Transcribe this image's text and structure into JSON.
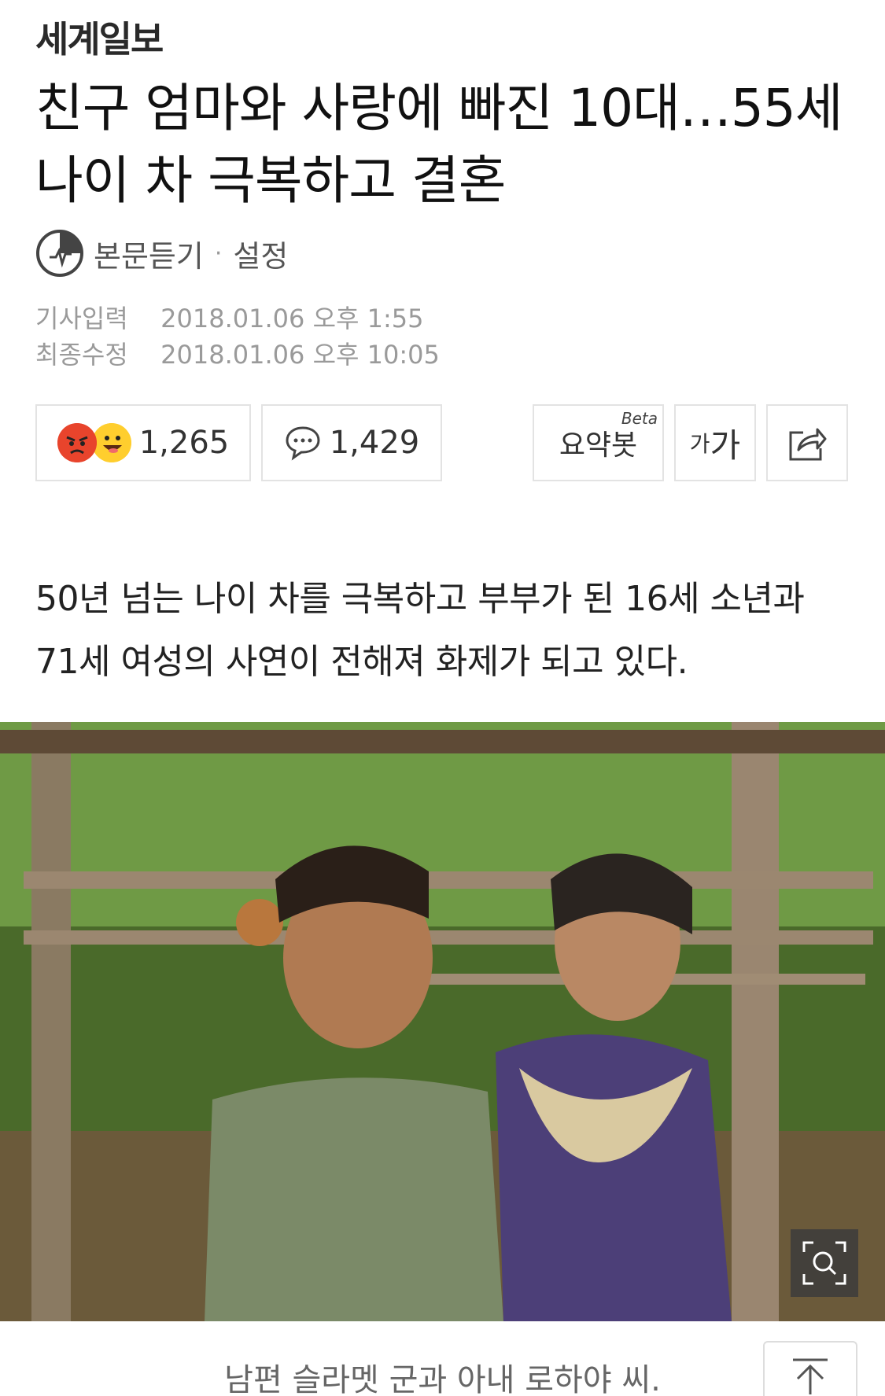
{
  "publisher": {
    "name": "세계일보"
  },
  "headline": "친구 엄마와 사랑에 빠진 10대…55세 나이 차 극복하고 결혼",
  "tts": {
    "label": "본문듣기",
    "separator": "·",
    "settings": "설정"
  },
  "meta": {
    "published_label": "기사입력",
    "published_value": "2018.01.06 오후 1:55",
    "modified_label": "최종수정",
    "modified_value": "2018.01.06 오후 10:05"
  },
  "actions": {
    "reaction_count": "1,265",
    "comment_count": "1,429",
    "summary_label": "요약봇",
    "summary_badge": "Beta",
    "font_small": "가",
    "font_big": "가"
  },
  "lead": "50년 넘는 나이 차를 극복하고 부부가 된 16세 소년과 71세 여성의 사연이 전해져 화제가 되고 있다.",
  "photo": {
    "caption": "남편 슬라멧 군과 아내 로하야 씨."
  },
  "colors": {
    "angry": "#e8442c",
    "happy": "#ffce2e",
    "border": "#e3e3e3"
  },
  "icons": [
    "tts-icon",
    "comment-icon",
    "share-icon",
    "zoom-icon",
    "arrow-up-icon"
  ]
}
